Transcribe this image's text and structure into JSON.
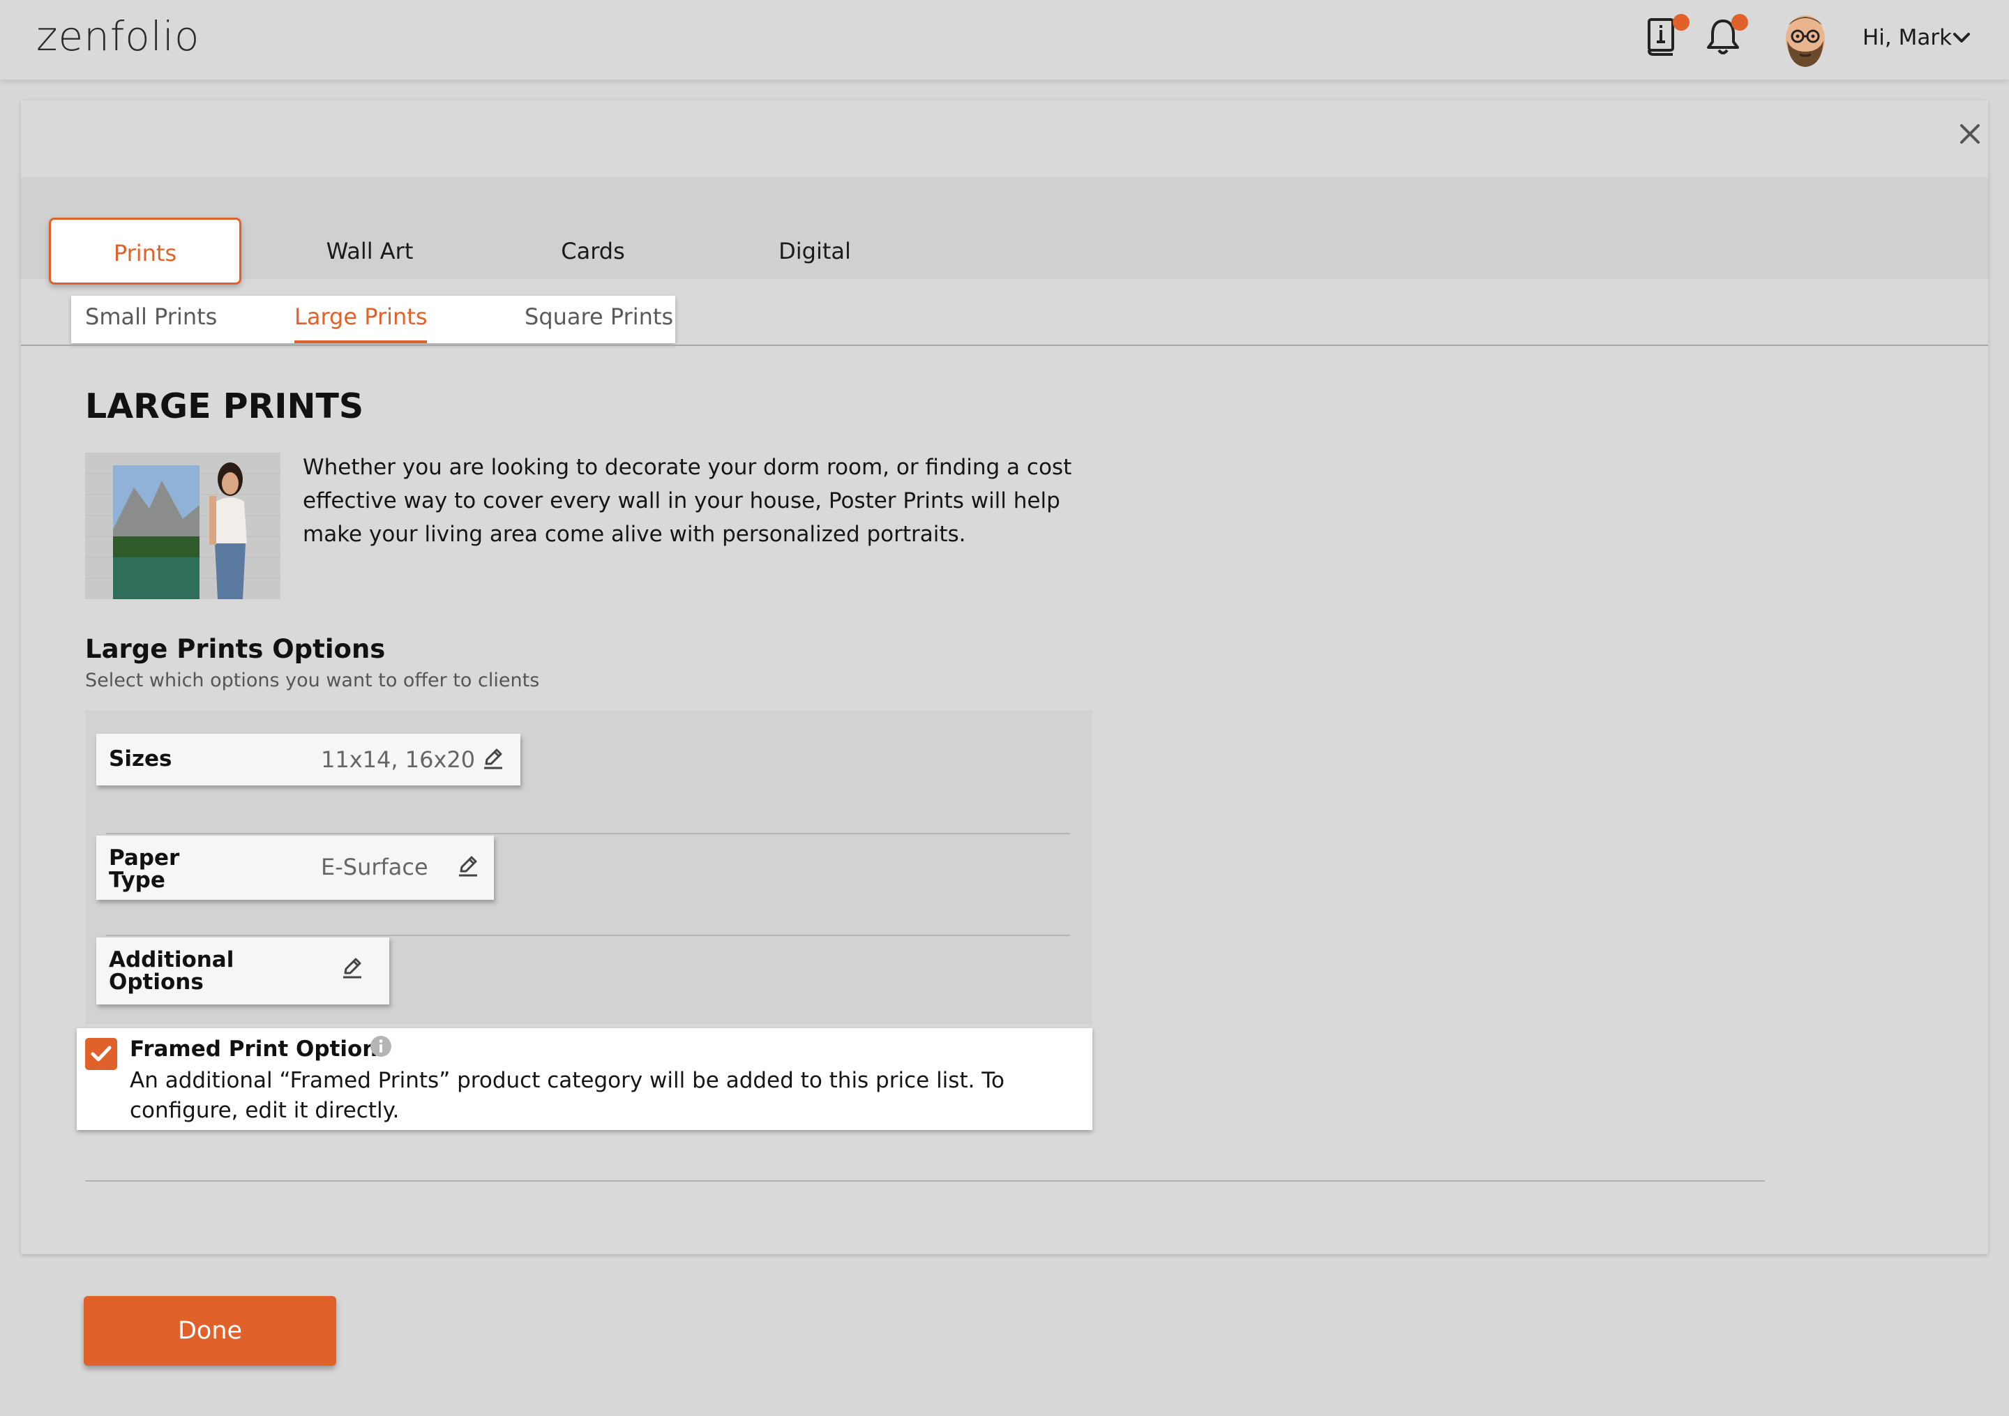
{
  "header": {
    "logo": "zenfolio",
    "greeting": "Hi, Mark"
  },
  "tabs": [
    {
      "label": "Prints",
      "active": true
    },
    {
      "label": "Wall Art",
      "active": false
    },
    {
      "label": "Cards",
      "active": false
    },
    {
      "label": "Digital",
      "active": false
    }
  ],
  "subtabs": [
    {
      "label": "Small Prints",
      "active": false
    },
    {
      "label": "Large Prints",
      "active": true
    },
    {
      "label": "Square Prints",
      "active": false
    }
  ],
  "section": {
    "title": "LARGE PRINTS",
    "description": "Whether you are looking to decorate your dorm room, or finding a cost effective way to cover every wall in your house, Poster Prints will help make your living area come alive with personalized portraits."
  },
  "options": {
    "title": "Large Prints Options",
    "subtitle": "Select which options you want to offer to clients",
    "items": [
      {
        "label": "Sizes",
        "value": "11x14, 16x20"
      },
      {
        "label": "Paper Type",
        "value": "E-Surface"
      },
      {
        "label": "Additional Options",
        "value": ""
      }
    ]
  },
  "framed": {
    "title": "Framed Print Option",
    "checked": true,
    "text": "An additional “Framed Prints” product category will be added to this price list. To configure, edit it directly."
  },
  "done_label": "Done",
  "colors": {
    "accent": "#e0622a",
    "background": "#d8d8d8"
  }
}
